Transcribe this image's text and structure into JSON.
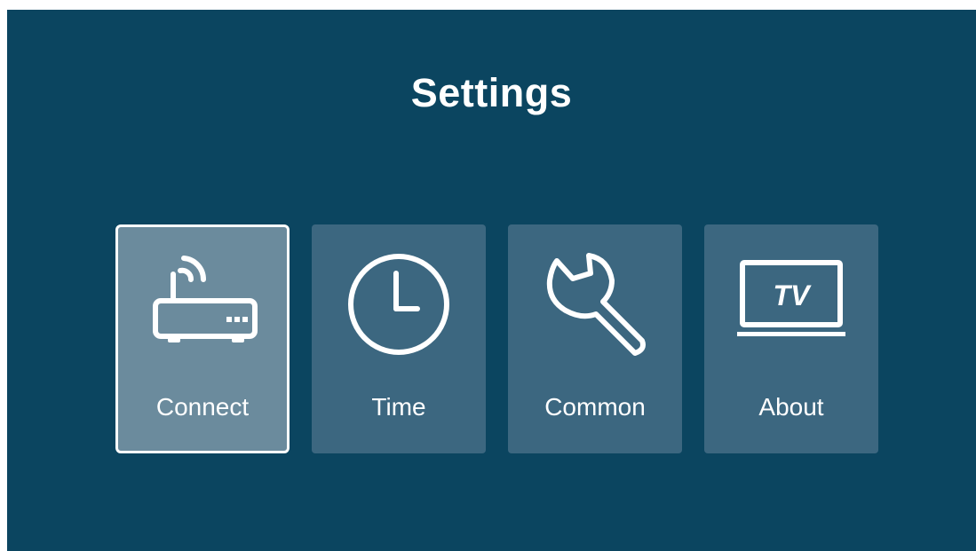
{
  "page": {
    "title": "Settings"
  },
  "colors": {
    "background": "#0b4560",
    "tile": "#3c6780",
    "tile_selected": "#6b8b9d",
    "text": "#ffffff"
  },
  "menu": {
    "selected": "connect",
    "items": [
      {
        "id": "connect",
        "label": "Connect",
        "icon": "router-icon"
      },
      {
        "id": "time",
        "label": "Time",
        "icon": "clock-icon"
      },
      {
        "id": "common",
        "label": "Common",
        "icon": "wrench-icon"
      },
      {
        "id": "about",
        "label": "About",
        "icon": "tv-icon"
      }
    ]
  }
}
